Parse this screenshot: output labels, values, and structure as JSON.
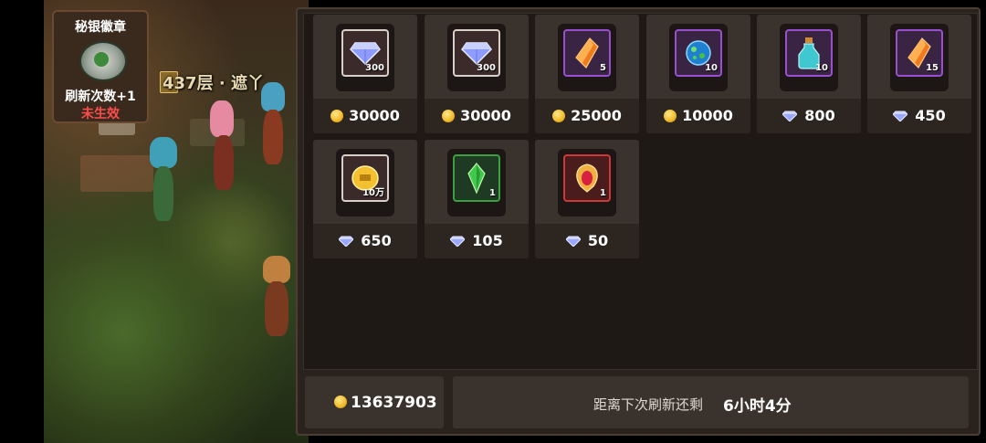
{
  "badge": {
    "title": "秘银徽章",
    "refresh": "刷新次数+1",
    "status": "未生效"
  },
  "scene": {
    "floor_label": "437层 · 遮丫"
  },
  "shop": {
    "items": [
      {
        "icon": "diamond-icon",
        "frame": "white",
        "qty": "300",
        "currency": "coin",
        "price": "30000"
      },
      {
        "icon": "diamond-icon",
        "frame": "white",
        "qty": "300",
        "currency": "coin",
        "price": "30000"
      },
      {
        "icon": "orange-crystal-icon",
        "frame": "purple",
        "qty": "5",
        "currency": "coin",
        "price": "25000"
      },
      {
        "icon": "blue-orb-icon",
        "frame": "purple",
        "qty": "10",
        "currency": "coin",
        "price": "10000"
      },
      {
        "icon": "potion-bottle-icon",
        "frame": "purple",
        "qty": "10",
        "currency": "diamond",
        "price": "800"
      },
      {
        "icon": "orange-crystal-icon",
        "frame": "purple",
        "qty": "15",
        "currency": "diamond",
        "price": "450"
      },
      {
        "icon": "gold-coin-icon",
        "frame": "white",
        "qty": "10万",
        "currency": "diamond",
        "price": "650"
      },
      {
        "icon": "green-crystal-icon",
        "frame": "green",
        "qty": "1",
        "currency": "diamond",
        "price": "105"
      },
      {
        "icon": "ruby-amulet-icon",
        "frame": "red",
        "qty": "1",
        "currency": "diamond",
        "price": "50"
      }
    ]
  },
  "footer": {
    "gold": "13637903",
    "refresh_label": "距离下次刷新还剩",
    "refresh_time": "6小时4分"
  },
  "colors": {
    "coin": "#f0b828",
    "diamond": "#9aa8ff",
    "status_red": "#ff4d4d"
  }
}
